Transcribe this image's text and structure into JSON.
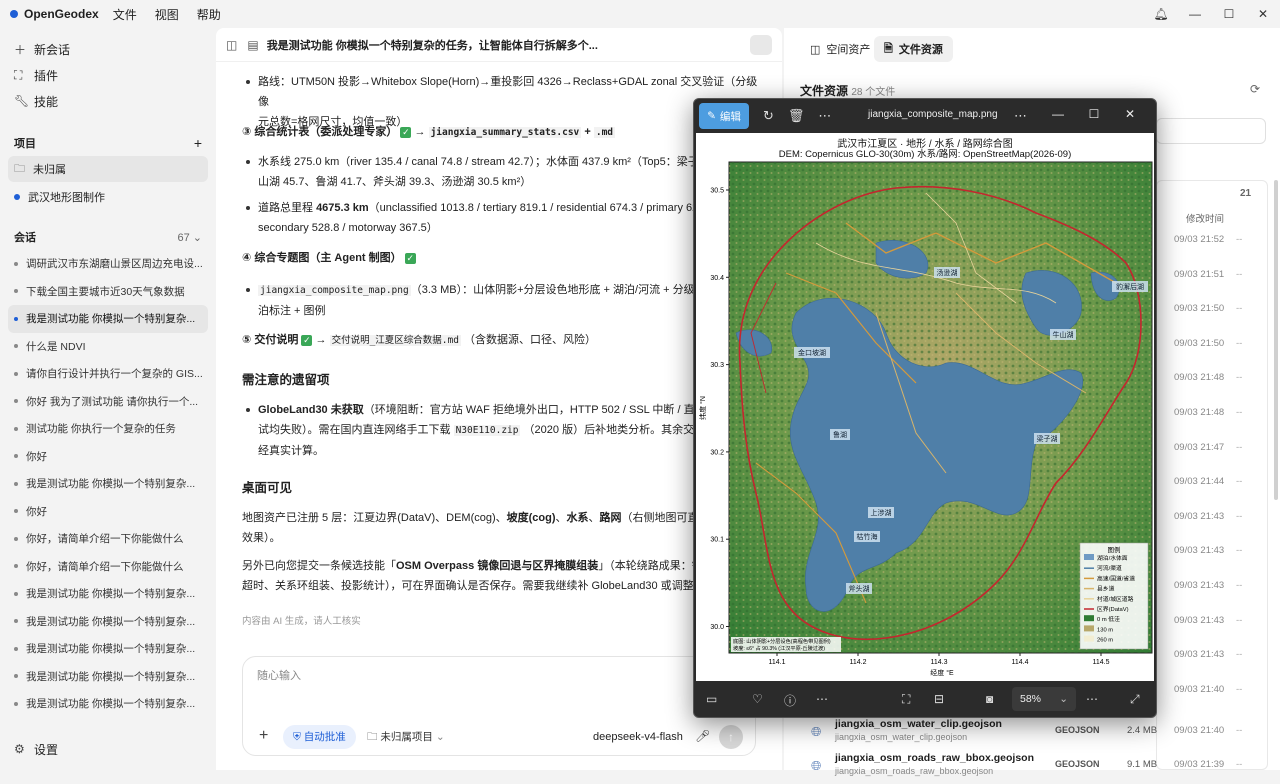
{
  "app": {
    "name": "OpenGeodex",
    "menus": [
      "文件",
      "视图",
      "帮助"
    ]
  },
  "sidebar": {
    "new_chat": "新会话",
    "plugins": "插件",
    "skills": "技能",
    "projects_header": "项目",
    "projects": [
      "未归属",
      "武汉地形图制作"
    ],
    "sessions_header": "会话",
    "sessions_count": "67",
    "sessions": [
      "调研武汉市东湖磨山景区周边充电设...",
      "下载全国主要城市近30天气象数据",
      "我是测试功能 你模拟一个特别复杂...",
      "什么是 NDVI",
      "请你自行设计并执行一个复杂的 GIS...",
      "你好 我为了测试功能 请你执行一个...",
      "测试功能 你执行一个复杂的任务",
      "你好",
      "我是测试功能 你模拟一个特别复杂...",
      "你好",
      "你好，请简单介绍一下你能做什么",
      "你好，请简单介绍一下你能做什么",
      "我是测试功能 你模拟一个特别复杂...",
      "我是测试功能 你模拟一个特别复杂...",
      "我是测试功能 你模拟一个特别复杂...",
      "我是测试功能 你模拟一个特别复杂...",
      "我是测试功能 你模拟一个特别复杂..."
    ],
    "settings": "设置"
  },
  "chat": {
    "title": "我是测试功能 你模拟一个特别复杂的任务，让智能体自行拆解多个...",
    "route_line1": "路线：UTM50N 投影→Whitebox Slope(Horn)→重投影回 4326→Reclass+GDAL zonal 交叉验证（分级像",
    "route_line2": "元总数=格网尺寸，均值一致）",
    "s3_title": "③ 综合统计表（委派处理专家）",
    "s3_arrow": "→",
    "s3_file": "jiangxia_summary_stats.csv",
    "s3_plus": "+",
    "s3_ext": ".md",
    "water_line1": "水系线 275.0 km（river 135.4 / canal 74.8 / stream 42.7）；水体面 437.9 km²（Top5：梁子湖",
    "water_line2": "山湖 45.7、鲁湖 41.7、斧头湖 39.3、汤逊湖 30.5 km²）",
    "road_pre": "道路总里程 ",
    "road_bold": "4675.3 km",
    "road_rest": "（unclassified 1013.8 / tertiary 819.1 / residential 674.3 / primary 622.",
    "road_line2": "secondary 528.8 / motorway 367.5）",
    "s4_title": "④ 综合专题图（主 Agent 制图）",
    "map_file": "jiangxia_composite_map.png",
    "map_desc": "（3.3 MB）：山体阴影+分层设色地形底 + 湖泊/河流 + 分级路网",
    "map_line2": "泊标注 + 图例",
    "s5_title": "⑤ 交付说明",
    "s5_arrow": "→",
    "s5_file": "交付说明_江夏区综合数据.md",
    "s5_desc": "（含数据源、口径、风险）",
    "left_title": "需注意的遗留项",
    "gl_bold": "GlobeLand30 未获取",
    "gl_rest": "（环境阻断：官方站 WAF 拒绝境外出口，HTTP 502 / SSL 中断 / 直连 R5",
    "gl_line2a": "试均失败）。需在国内直连网络手工下载 ",
    "gl_code": "N30E110.zip",
    "gl_line2b": " （2020 版）后补地类分析。其余交付物均",
    "gl_line3": "经真实计算。",
    "desk_title": "桌面可见",
    "desk_line1a": "地图资产已注册 5 层：江夏边界(DataV)、DEM(cog)、",
    "desk_b1": "坡度(cog)",
    "desk_c1": "、",
    "desk_b2": "水系",
    "desk_c2": "、",
    "desk_b3": "路网",
    "desk_line1b": "（右侧地图可直接预览",
    "desk_line2": "效果）。",
    "skill_line1a": "另外已向您提交一条候选技能「",
    "skill_bold": "OSM Overpass 镜像回退与区界掩膜组装",
    "skill_line1b": "」（本轮绕路成果：镜像",
    "skill_line2": "超时、关系环组装、投影统计），可在界面确认是否保存。需要我继续补 GlobeLand30 或调整任何成",
    "ai_note": "内容由 AI 生成，请人工核实",
    "input_placeholder": "随心输入",
    "auto_approve": "自动批准",
    "project_select": "未归属项目",
    "model": "deepseek-v4-flash"
  },
  "right": {
    "tab_spatial": "空间资产",
    "tab_files": "文件资源",
    "files_title": "文件资源",
    "files_count": "28 个文件",
    "list_count": "21",
    "modified_header": "修改时间",
    "times": [
      "09/03 21:52",
      "09/03 21:51",
      "09/03 21:50",
      "09/03 21:50",
      "09/03 21:48",
      "09/03 21:48",
      "09/03 21:47",
      "09/03 21:44",
      "09/03 21:43",
      "09/03 21:43",
      "09/03 21:43",
      "09/03 21:43",
      "09/03 21:43",
      "09/03 21:40"
    ],
    "files": [
      {
        "name": "jiangxia_osm_water_clip.geojson",
        "sub": "jiangxia_osm_water_clip.geojson",
        "type": "GEOJSON",
        "size": "2.4 MB",
        "time": "09/03 21:40"
      },
      {
        "name": "jiangxia_osm_roads_raw_bbox.geojson",
        "sub": "jiangxia_osm_roads_raw_bbox.geojson",
        "type": "GEOJSON",
        "size": "9.1 MB",
        "time": "09/03 21:39"
      }
    ],
    "dash": "--"
  },
  "viewer": {
    "edit": "编辑",
    "filename": "jiangxia_composite_map.png",
    "zoom": "58%",
    "map_title1": "武汉市江夏区 · 地形 / 水系 / 路网综合图",
    "map_title2": "DEM: Copernicus GLO-30(30m)   水系/路网: OpenStreetMap(2026-09)",
    "ylabel": "纬度 °N",
    "xlabel": "经度 °E",
    "xticks": [
      "114.1",
      "114.2",
      "114.3",
      "114.4",
      "114.5"
    ],
    "yticks": [
      "30.5",
      "30.4",
      "30.3",
      "30.2",
      "30.1",
      "30.0"
    ],
    "lakes": [
      "汤逊湖",
      "豹澥后湖",
      "牛山湖",
      "金口坡湖",
      "鲁湖",
      "梁子湖",
      "上涉湖",
      "枯竹海",
      "斧头湖"
    ],
    "legend_title": "图例",
    "legend": [
      "湖泊/水体面",
      "河流/渠道",
      "高速/国道/省道",
      "县乡道",
      "村道/城区道路",
      "区界(DataV)",
      "0 m 低洼",
      "130 m",
      "260 m"
    ],
    "footnote1": "底图: 山体阴影+分层设色(高程色带见图例)",
    "footnote2": "坡度: ≤6° 占 90.3% (江汉平原-丘陵过渡)"
  }
}
